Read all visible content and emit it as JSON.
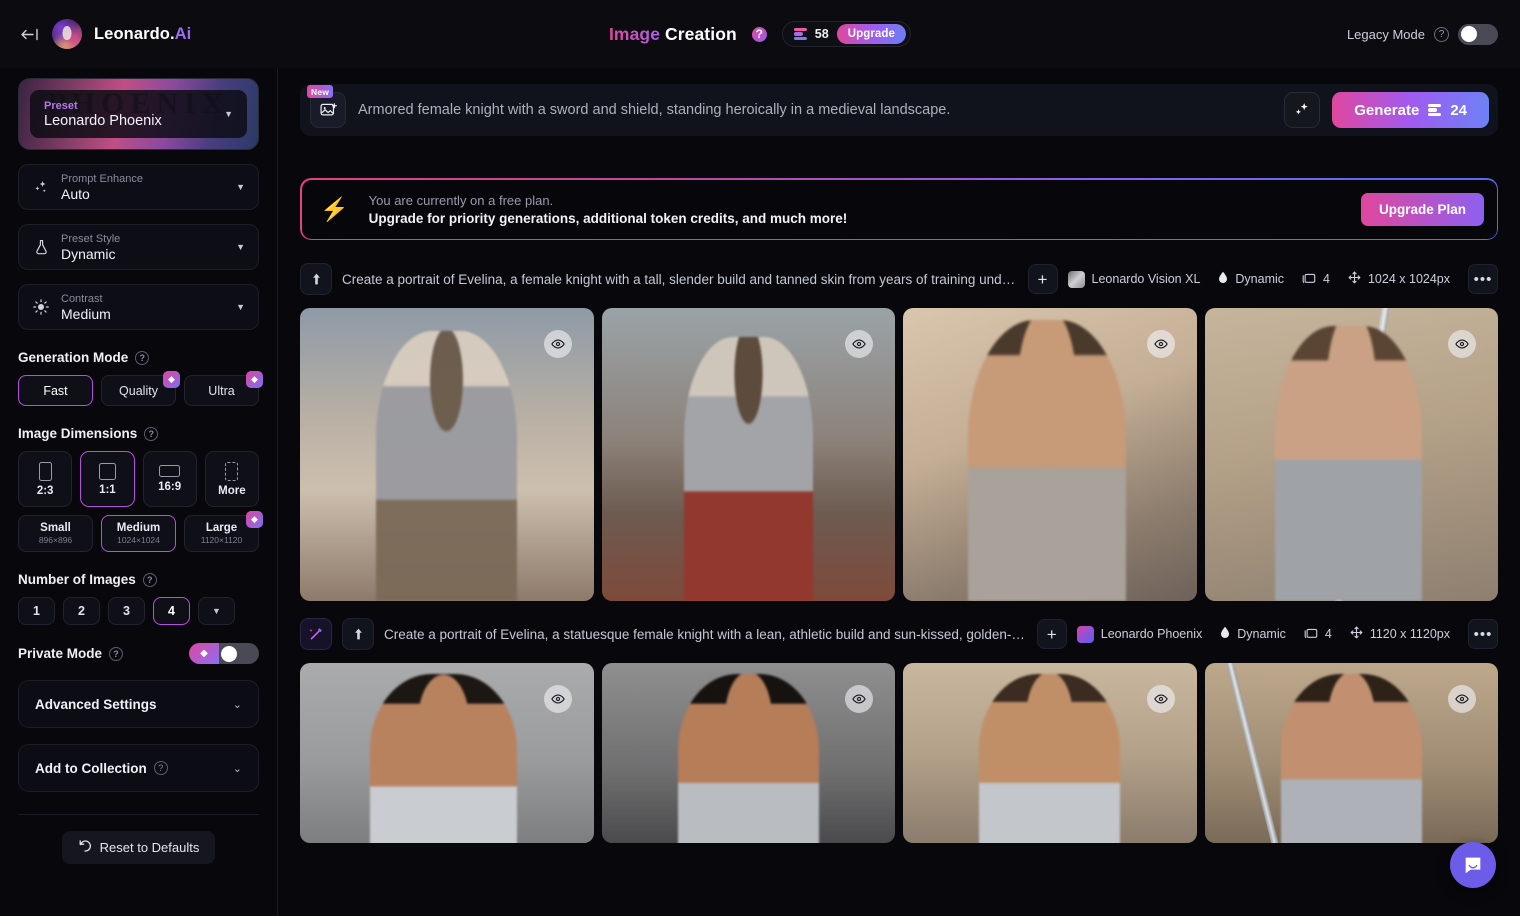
{
  "topbar": {
    "collapse_icon": "collapse-sidebar-icon",
    "brand_name": "Leonardo.",
    "brand_suffix": "Ai",
    "title_word1": "Image",
    "title_word2": "Creation",
    "help_glyph": "?",
    "token_count": "58",
    "upgrade_label": "Upgrade",
    "legacy_mode_label": "Legacy Mode",
    "legacy_help_glyph": "?",
    "legacy_mode_on": false
  },
  "sidebar": {
    "preset": {
      "label": "Preset",
      "value": "Leonardo Phoenix",
      "bg_text": "PHOENIX"
    },
    "selects": [
      {
        "label": "Prompt Enhance",
        "value": "Auto",
        "icon": "sparkles-icon"
      },
      {
        "label": "Preset Style",
        "value": "Dynamic",
        "icon": "flask-icon"
      },
      {
        "label": "Contrast",
        "value": "Medium",
        "icon": "brightness-icon"
      }
    ],
    "generation_mode": {
      "title": "Generation Mode",
      "help": "?",
      "options": [
        {
          "label": "Fast",
          "selected": true,
          "premium": false
        },
        {
          "label": "Quality",
          "selected": false,
          "premium": true
        },
        {
          "label": "Ultra",
          "selected": false,
          "premium": true
        }
      ]
    },
    "image_dimensions": {
      "title": "Image Dimensions",
      "help": "?",
      "ratios": [
        {
          "label": "2:3",
          "selected": false
        },
        {
          "label": "1:1",
          "selected": true
        },
        {
          "label": "16:9",
          "selected": false
        },
        {
          "label": "More",
          "selected": false
        }
      ],
      "sizes": [
        {
          "name": "Small",
          "px": "896×896",
          "selected": false,
          "premium": false
        },
        {
          "name": "Medium",
          "px": "1024×1024",
          "selected": true,
          "premium": false
        },
        {
          "name": "Large",
          "px": "1120×1120",
          "selected": false,
          "premium": true
        }
      ]
    },
    "number_of_images": {
      "title": "Number of Images",
      "help": "?",
      "options": [
        "1",
        "2",
        "3",
        "4"
      ],
      "selected": "4",
      "more_glyph": "▼"
    },
    "private_mode": {
      "title": "Private Mode",
      "help": "?",
      "enabled": false,
      "premium": true
    },
    "advanced_settings": {
      "title": "Advanced Settings",
      "expanded": false
    },
    "add_to_collection": {
      "title": "Add to Collection",
      "help": "?",
      "expanded": false
    },
    "reset_button": {
      "label": "Reset to Defaults",
      "icon": "undo-icon"
    }
  },
  "main": {
    "prompt_bar": {
      "new_badge": "New",
      "image_icon": "image-add-icon",
      "prompt": "Armored female knight with a sword and shield, standing heroically in a medieval landscape.",
      "spark_icon": "sparkle-enhance-icon",
      "generate_label": "Generate",
      "generate_cost": "24"
    },
    "free_banner": {
      "icon": "lightning-bolt-icon",
      "line1": "You are currently on a free plan.",
      "line2": "Upgrade for priority generations, additional token credits, and much more!",
      "cta": "Upgrade Plan"
    },
    "results": [
      {
        "has_magic_button": false,
        "upload_icon": "upload-arrow-icon",
        "prompt": "Create a portrait of Evelina, a female knight with a tall, slender build and tanned skin from years of training under...",
        "add_label": "+",
        "model": "Leonardo Vision XL",
        "style": "Dynamic",
        "count": "4",
        "dimensions": "1024 x 1024px",
        "menu_glyph": "•••",
        "images": [
          {
            "alt": "knight-portrait-1",
            "class": "k1"
          },
          {
            "alt": "knight-portrait-2",
            "class": "k2"
          },
          {
            "alt": "knight-portrait-3",
            "class": "k3"
          },
          {
            "alt": "knight-portrait-4",
            "class": "k4"
          }
        ]
      },
      {
        "has_magic_button": true,
        "magic_icon": "magic-wand-icon",
        "upload_icon": "upload-arrow-icon",
        "prompt": "Create a portrait of Evelina, a statuesque female knight with a lean, athletic build and sun-kissed, golden-brown...",
        "add_label": "+",
        "model": "Leonardo Phoenix",
        "style": "Dynamic",
        "count": "4",
        "dimensions": "1120 x 1120px",
        "menu_glyph": "•••",
        "images": [
          {
            "alt": "knight-portrait-5",
            "class": "k5"
          },
          {
            "alt": "knight-portrait-6",
            "class": "k6"
          },
          {
            "alt": "knight-portrait-7",
            "class": "k7"
          },
          {
            "alt": "knight-portrait-8",
            "class": "k8"
          }
        ]
      }
    ],
    "chat_fab": {
      "icon": "chat-bubble-icon"
    }
  },
  "colors": {
    "accent_pink": "#e0479e",
    "accent_purple": "#9b5ef0",
    "accent_blue": "#6c7ef5",
    "selected_border": "#b64fe0",
    "bolt_orange": "#f0721f",
    "chat_purple": "#6c5ce7"
  }
}
